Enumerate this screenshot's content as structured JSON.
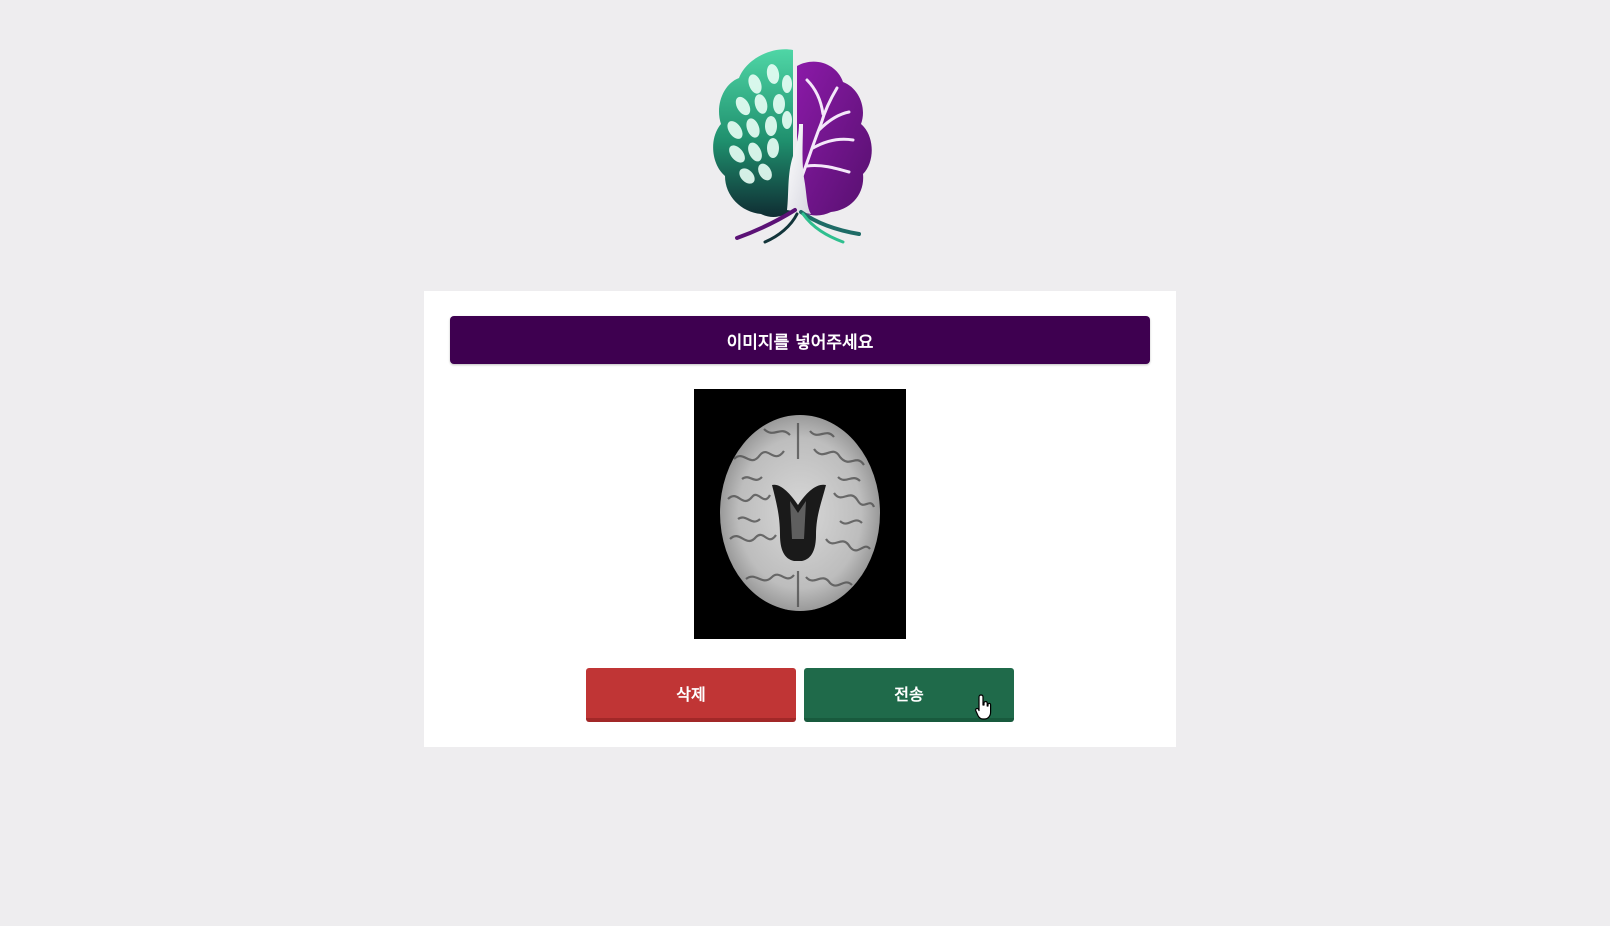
{
  "logo": {
    "name": "brain-tree-logo",
    "colors": {
      "left": "#2fbf8f",
      "right": "#7a1598",
      "dark": "#12353a"
    }
  },
  "upload": {
    "header_label": "이미지를 넣어주세요"
  },
  "preview": {
    "alt": "brain MRI scan"
  },
  "actions": {
    "delete_label": "삭제",
    "send_label": "전송"
  },
  "colors": {
    "background": "#eeedef",
    "header": "#3e0050",
    "delete": "#c03535",
    "send": "#1f6a4a"
  }
}
